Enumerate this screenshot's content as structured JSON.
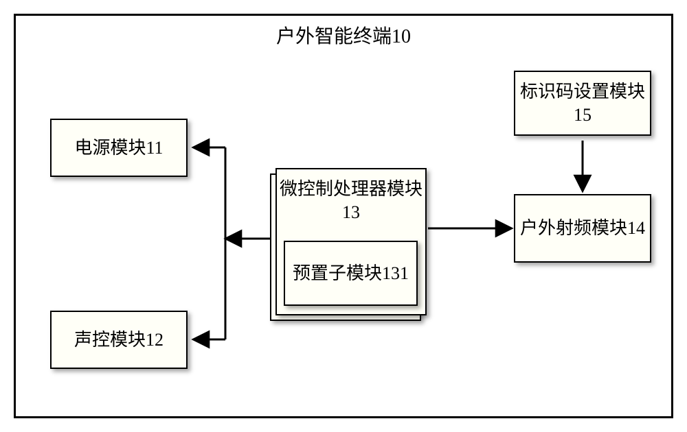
{
  "diagram": {
    "title": "户外智能终端10",
    "nodes": {
      "power": {
        "label": "电源模块11"
      },
      "voice": {
        "label": "声控模块12"
      },
      "mcu": {
        "label": "微控制处理器模块13"
      },
      "preset": {
        "label": "预置子模块131"
      },
      "id": {
        "label": "标识码设置模块15"
      },
      "rf": {
        "label": "户外射频模块14"
      }
    },
    "edges": [
      {
        "from": "mcu",
        "to": "power",
        "direction": "to"
      },
      {
        "from": "mcu",
        "to": "voice",
        "direction": "to"
      },
      {
        "from": "mcu",
        "to": "rf",
        "direction": "to"
      },
      {
        "from": "id",
        "to": "rf",
        "direction": "to"
      }
    ]
  }
}
